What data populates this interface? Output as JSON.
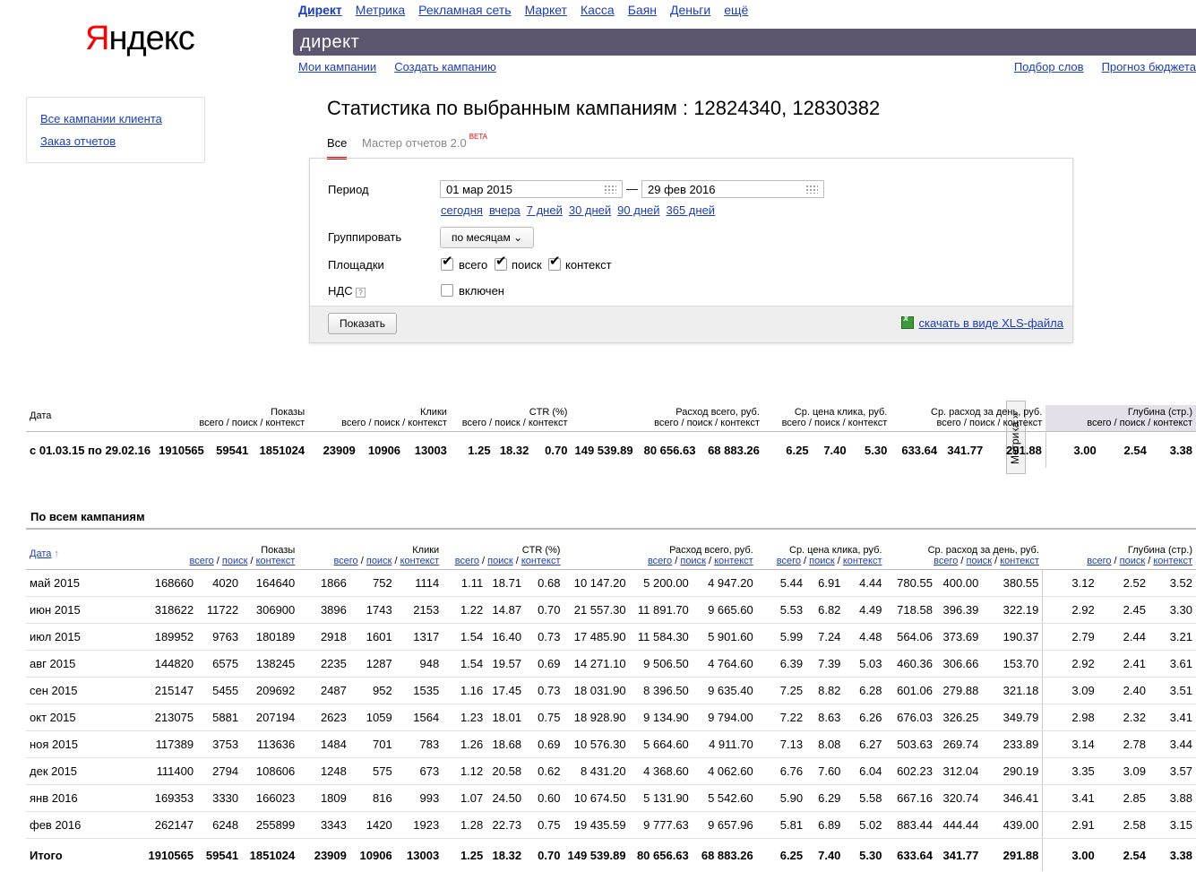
{
  "header": {
    "logo": {
      "first": "Я",
      "rest": "ндекс"
    },
    "services": [
      {
        "label": "Директ",
        "current": true
      },
      {
        "label": "Метрика"
      },
      {
        "label": "Рекламная сеть"
      },
      {
        "label": "Маркет"
      },
      {
        "label": "Касса"
      },
      {
        "label": "Баян"
      },
      {
        "label": "Деньги"
      },
      {
        "label": "ещё"
      }
    ],
    "banner": "директ",
    "subnav": [
      "Мои кампании",
      "Создать кампанию"
    ],
    "rightnav": [
      "Подбор слов",
      "Прогноз бюджета"
    ]
  },
  "sidebar": {
    "items": [
      "Все кампании клиента",
      "Заказ отчетов"
    ]
  },
  "page": {
    "title": "Статистика по выбранным кампаниям : 12824340, 12830382",
    "tabs": {
      "all": "Все",
      "master": "Мастер отчетов 2.0",
      "beta": "BETA"
    }
  },
  "filter": {
    "period_label": "Период",
    "date_from": "01 мар 2015",
    "dash": "—",
    "date_to": "29 фев 2016",
    "quick": [
      "сегодня",
      "вчера",
      "7 дней",
      "30 дней",
      "90 дней",
      "365 дней"
    ],
    "group_label": "Группировать",
    "group_value": "по месяцам",
    "platforms_label": "Площадки",
    "platforms": [
      {
        "label": "всего",
        "checked": true
      },
      {
        "label": "поиск",
        "checked": true
      },
      {
        "label": "контекст",
        "checked": true
      }
    ],
    "vat_label": "НДС",
    "vat_help": "?",
    "vat_option": "включен",
    "show_button": "Показать",
    "xls_link": "скачать в виде XLS-файла"
  },
  "columns": {
    "date": "Дата",
    "sort_arrow": "↑",
    "shows": "Показы",
    "clicks": "Клики",
    "ctr": "CTR (%)",
    "spend": "Расход всего, руб.",
    "cpc": "Ср. цена клика, руб.",
    "daily": "Ср. расход за день, руб.",
    "depth": "Глубина (стр.)",
    "all": "всего",
    "search": "поиск",
    "context": "контекст",
    "slash": " / "
  },
  "metrika_tab": "Метрика »",
  "summary": [
    "с 01.03.15 по 29.02.16",
    "1910565",
    "59541",
    "1851024",
    "23909",
    "10906",
    "13003",
    "1.25",
    "18.32",
    "0.70",
    "149 539.89",
    "80 656.63",
    "68 883.26",
    "6.25",
    "7.40",
    "5.30",
    "633.64",
    "341.77",
    "291.88",
    "3.00",
    "2.54",
    "3.38"
  ],
  "section_title": "По всем кампаниям",
  "rows": [
    [
      "май 2015",
      "168660",
      "4020",
      "164640",
      "1866",
      "752",
      "1114",
      "1.11",
      "18.71",
      "0.68",
      "10 147.20",
      "5 200.00",
      "4 947.20",
      "5.44",
      "6.91",
      "4.44",
      "780.55",
      "400.00",
      "380.55",
      "3.12",
      "2.52",
      "3.52"
    ],
    [
      "июн 2015",
      "318622",
      "11722",
      "306900",
      "3896",
      "1743",
      "2153",
      "1.22",
      "14.87",
      "0.70",
      "21 557.30",
      "11 891.70",
      "9 665.60",
      "5.53",
      "6.82",
      "4.49",
      "718.58",
      "396.39",
      "322.19",
      "2.92",
      "2.45",
      "3.30"
    ],
    [
      "июл 2015",
      "189952",
      "9763",
      "180189",
      "2918",
      "1601",
      "1317",
      "1.54",
      "16.40",
      "0.73",
      "17 485.90",
      "11 584.30",
      "5 901.60",
      "5.99",
      "7.24",
      "4.48",
      "564.06",
      "373.69",
      "190.37",
      "2.79",
      "2.44",
      "3.21"
    ],
    [
      "авг 2015",
      "144820",
      "6575",
      "138245",
      "2235",
      "1287",
      "948",
      "1.54",
      "19.57",
      "0.69",
      "14 271.10",
      "9 506.50",
      "4 764.60",
      "6.39",
      "7.39",
      "5.03",
      "460.36",
      "306.66",
      "153.70",
      "2.92",
      "2.41",
      "3.61"
    ],
    [
      "сен 2015",
      "215147",
      "5455",
      "209692",
      "2487",
      "952",
      "1535",
      "1.16",
      "17.45",
      "0.73",
      "18 031.90",
      "8 396.50",
      "9 635.40",
      "7.25",
      "8.82",
      "6.28",
      "601.06",
      "279.88",
      "321.18",
      "3.09",
      "2.40",
      "3.51"
    ],
    [
      "окт 2015",
      "213075",
      "5881",
      "207194",
      "2623",
      "1059",
      "1564",
      "1.23",
      "18.01",
      "0.75",
      "18 928.90",
      "9 134.90",
      "9 794.00",
      "7.22",
      "8.63",
      "6.26",
      "676.03",
      "326.25",
      "349.79",
      "2.98",
      "2.32",
      "3.41"
    ],
    [
      "ноя 2015",
      "117389",
      "3753",
      "113636",
      "1484",
      "701",
      "783",
      "1.26",
      "18.68",
      "0.69",
      "10 576.30",
      "5 664.60",
      "4 911.70",
      "7.13",
      "8.08",
      "6.27",
      "503.63",
      "269.74",
      "233.89",
      "3.14",
      "2.78",
      "3.44"
    ],
    [
      "дек 2015",
      "111400",
      "2794",
      "108606",
      "1248",
      "575",
      "673",
      "1.12",
      "20.58",
      "0.62",
      "8 431.20",
      "4 368.60",
      "4 062.60",
      "6.76",
      "7.60",
      "6.04",
      "602.23",
      "312.04",
      "290.19",
      "3.35",
      "3.09",
      "3.57"
    ],
    [
      "янв 2016",
      "169353",
      "3330",
      "166023",
      "1809",
      "816",
      "993",
      "1.07",
      "24.50",
      "0.60",
      "10 674.50",
      "5 131.90",
      "5 542.60",
      "5.90",
      "6.29",
      "5.58",
      "667.16",
      "320.74",
      "346.41",
      "3.41",
      "2.85",
      "3.88"
    ],
    [
      "фев 2016",
      "262147",
      "6248",
      "255899",
      "3343",
      "1420",
      "1923",
      "1.28",
      "22.73",
      "0.75",
      "19 435.59",
      "9 777.63",
      "9 657.96",
      "5.81",
      "6.89",
      "5.02",
      "883.44",
      "444.44",
      "439.00",
      "2.91",
      "2.58",
      "3.15"
    ]
  ],
  "total": [
    "Итого",
    "1910565",
    "59541",
    "1851024",
    "23909",
    "10906",
    "13003",
    "1.25",
    "18.32",
    "0.70",
    "149 539.89",
    "80 656.63",
    "68 883.26",
    "6.25",
    "7.40",
    "5.30",
    "633.64",
    "341.77",
    "291.88",
    "3.00",
    "2.54",
    "3.38"
  ]
}
